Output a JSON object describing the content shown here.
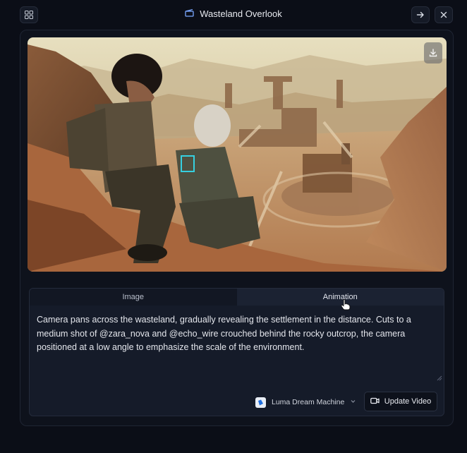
{
  "header": {
    "title": "Wasteland Overlook",
    "grid_icon": "grid-icon",
    "title_icon": "clapperboard-icon",
    "forward_icon": "arrow-right-icon",
    "close_icon": "close-icon"
  },
  "media": {
    "image_alt_icon": "generated-image",
    "download_icon": "download-icon"
  },
  "tabs": [
    {
      "label": "Image",
      "active": false
    },
    {
      "label": "Animation",
      "active": true
    }
  ],
  "prompt": {
    "text": "Camera pans across the wasteland, gradually revealing the settlement in the distance. Cuts to a medium shot of @zara_nova and @echo_wire crouched behind the rocky outcrop, the camera positioned at a low angle to emphasize the scale of the environment."
  },
  "model_selector": {
    "label": "Luma Dream Machine",
    "icon": "luma-logo-icon"
  },
  "actions": {
    "update_label": "Update Video",
    "update_icon": "video-camera-icon"
  },
  "colors": {
    "background": "#0b0e17",
    "panel": "#151b29",
    "accent_text": "#e8eaf0"
  }
}
